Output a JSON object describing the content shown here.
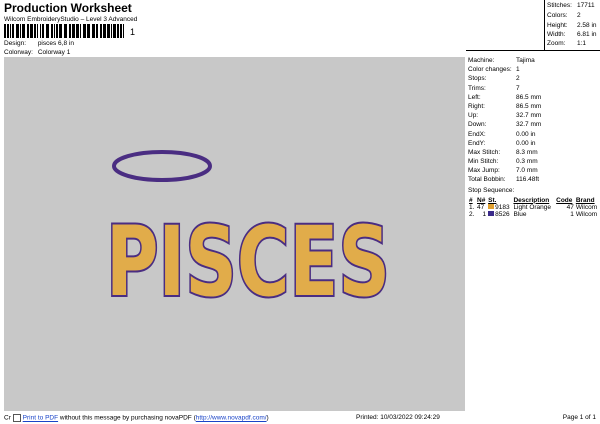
{
  "header": {
    "title": "Production Worksheet",
    "subtitle": "Wilcom EmbroideryStudio – Level 3 Advanced",
    "barcode_suffix": "1",
    "design_label": "Design:",
    "design_value": "pisces 6,8 in",
    "colorway_label": "Colorway:",
    "colorway_value": "Colorway 1"
  },
  "stats": [
    {
      "label": "Stitches:",
      "value": "17711"
    },
    {
      "label": "Colors:",
      "value": "2"
    },
    {
      "label": "Height:",
      "value": "2.58 in"
    },
    {
      "label": "Width:",
      "value": "6.81 in"
    },
    {
      "label": "Zoom:",
      "value": "1:1"
    }
  ],
  "design_text": "PISCES",
  "details": [
    {
      "label": "Machine:",
      "value": "Tajima"
    },
    {
      "label": "Color changes:",
      "value": "1"
    },
    {
      "label": "Stops:",
      "value": "2"
    },
    {
      "label": "Trims:",
      "value": "7"
    },
    {
      "label": "Left:",
      "value": "86.5 mm"
    },
    {
      "label": "Right:",
      "value": "86.5 mm"
    },
    {
      "label": "Up:",
      "value": "32.7 mm"
    },
    {
      "label": "Down:",
      "value": "32.7 mm"
    },
    {
      "label": "EndX:",
      "value": "0.00 in"
    },
    {
      "label": "EndY:",
      "value": "0.00 in"
    },
    {
      "label": "Max Stitch:",
      "value": "8.3 mm"
    },
    {
      "label": "Min Stitch:",
      "value": "0.3 mm"
    },
    {
      "label": "Max Jump:",
      "value": "7.0 mm"
    },
    {
      "label": "Total Bobbin:",
      "value": "116.48ft"
    }
  ],
  "stop_sequence": {
    "title": "Stop Sequence:",
    "headers": [
      "#",
      "N#",
      "St.",
      "Description",
      "Code",
      "Brand"
    ],
    "rows": [
      {
        "num": "1.",
        "n": "47",
        "st": "9183",
        "desc": "Light Orange",
        "code": "47",
        "brand": "Wilcom",
        "color": "#e0a030"
      },
      {
        "num": "2.",
        "n": "1",
        "st": "8526",
        "desc": "Blue",
        "code": "1",
        "brand": "Wilcom",
        "color": "#3a2a8a"
      }
    ]
  },
  "footer": {
    "prefix": "Cr",
    "link1": "Print to PDF",
    "middle": " without this message by purchasing novaPDF (",
    "link2": "http://www.novapdf.com/",
    "suffix": ")",
    "printed": "Printed: 10/03/2022 09:24:29",
    "page": "Page 1 of 1"
  },
  "colors": {
    "fill": "#e1ac4a",
    "outline": "#4a2d82",
    "halo": "#4a2d82",
    "canvas": "#c8c8c8"
  }
}
